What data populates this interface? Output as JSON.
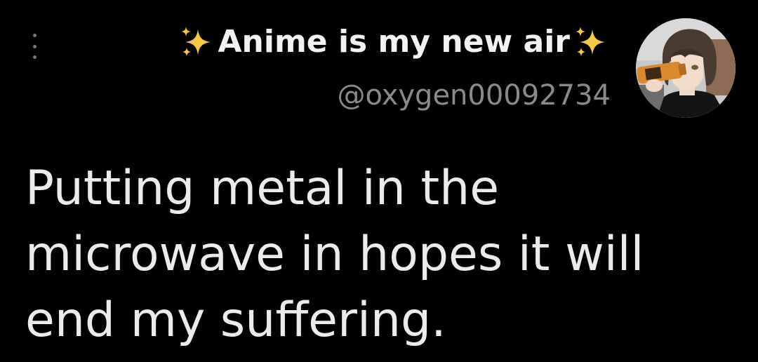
{
  "tweet": {
    "display_name": "Anime is my new air",
    "leading_emoji": "sparkles-icon",
    "trailing_emoji": "sparkles-icon",
    "handle": "@oxygen00092734",
    "avatar": "anime-character-drinking-avatar",
    "text_lines": [
      "Putting metal in the",
      "microwave in hopes it will",
      "end my suffering."
    ]
  },
  "menu": {
    "icon": "vertical-dots-icon"
  },
  "colors": {
    "background": "#000000",
    "name_text": "#f2f2f2",
    "handle_text": "#8a8a8a",
    "body_text": "#ebebeb",
    "sparkle": "#f7c740"
  }
}
